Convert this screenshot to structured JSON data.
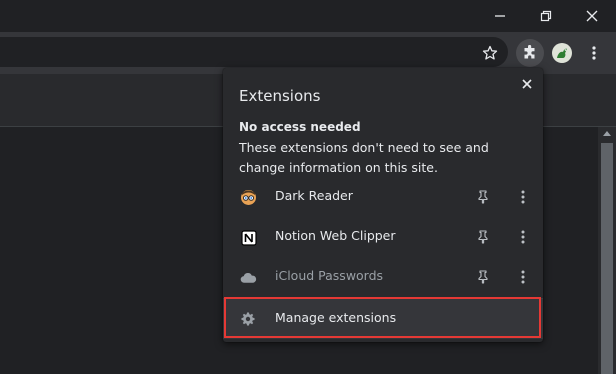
{
  "window": {
    "controls": [
      "minimize",
      "restore",
      "close"
    ]
  },
  "toolbar": {
    "icons": [
      "bookmark-star-icon",
      "extensions-puzzle-icon",
      "profile-avatar",
      "more-menu-icon"
    ]
  },
  "extensions_popup": {
    "title": "Extensions",
    "section_heading": "No access needed",
    "section_description": "These extensions don't need to see and change information on this site.",
    "extensions": [
      {
        "name": "Dark Reader",
        "icon": "dark-reader-icon",
        "enabled": true
      },
      {
        "name": "Notion Web Clipper",
        "icon": "notion-icon",
        "enabled": true
      },
      {
        "name": "iCloud Passwords",
        "icon": "icloud-icon",
        "enabled": false
      }
    ],
    "manage_label": "Manage extensions"
  },
  "colors": {
    "titlebar_bg": "#202124",
    "toolbar_bg": "#35363a",
    "popup_bg": "#292a2d",
    "text": "#e8eaed",
    "dim_text": "#9aa0a6",
    "highlight_border": "#e53935"
  }
}
